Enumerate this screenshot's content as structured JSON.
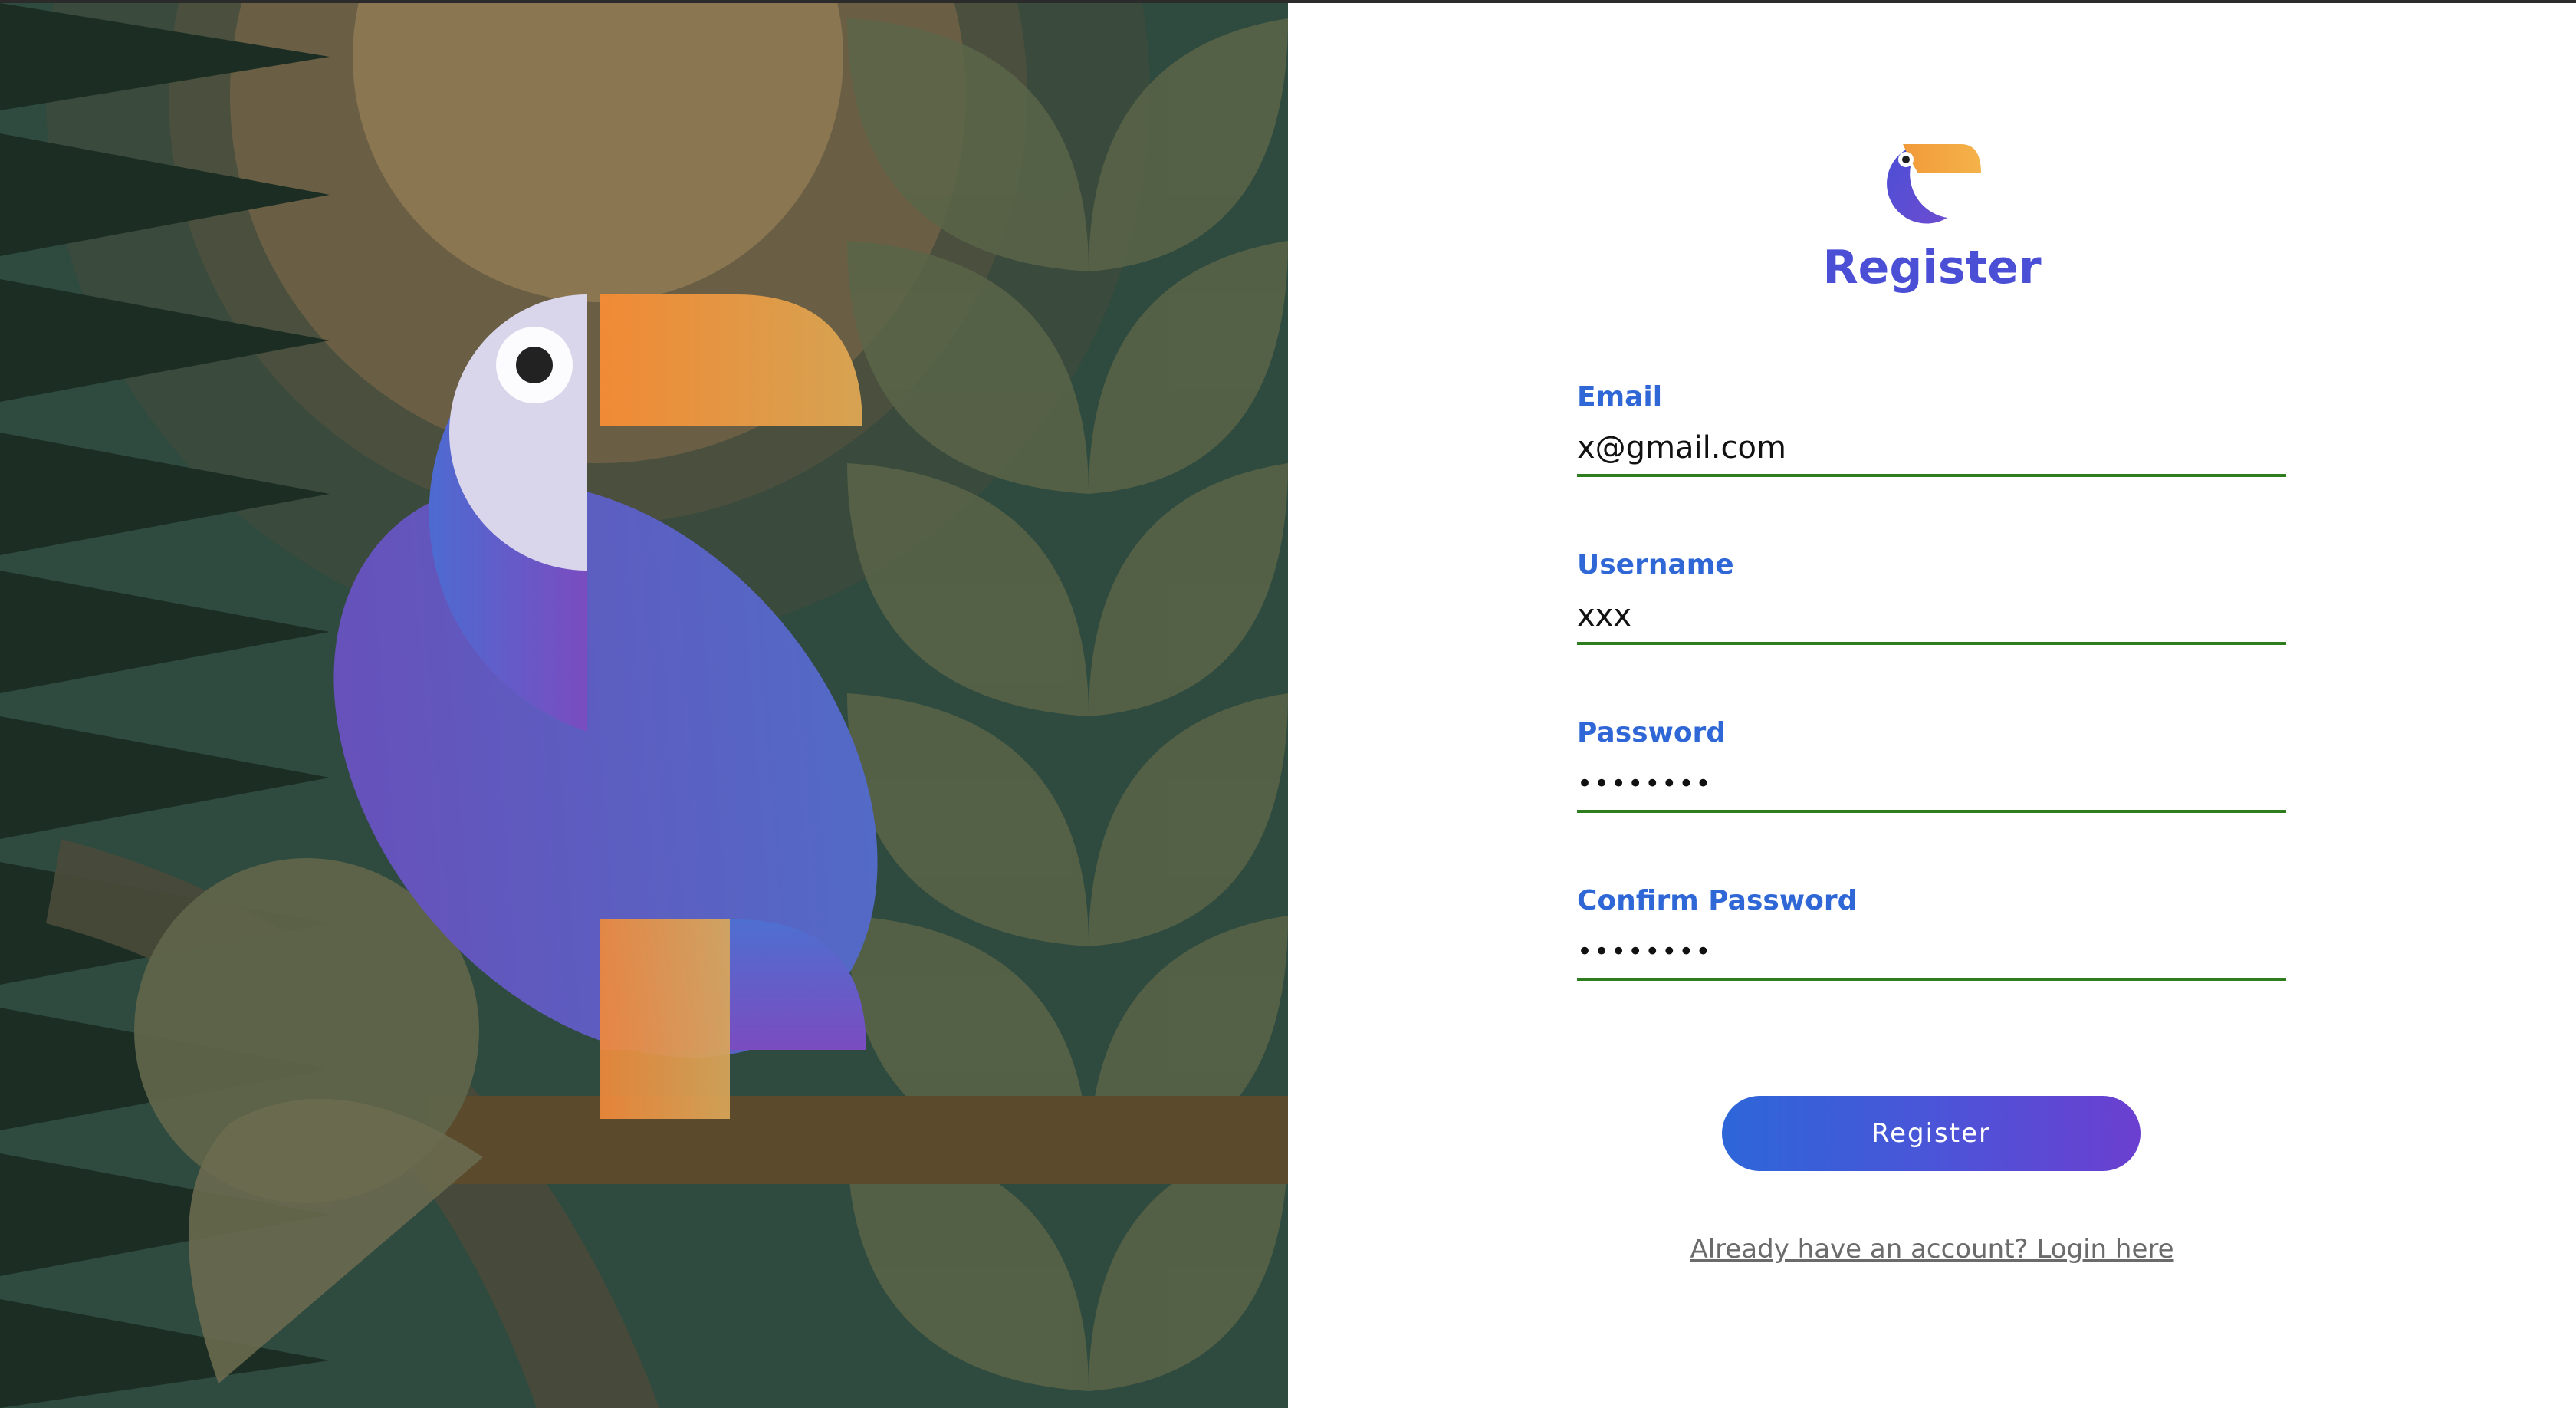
{
  "art": {
    "subject": "toucan-illustration",
    "colors": {
      "background": "#2f4a3f",
      "dark_leaves": "#1c2e24",
      "sun": "#8a7651",
      "leaves": "#5a6548",
      "body_start": "#4d6bd1",
      "body_end": "#7a4cc0",
      "face": "#d9d6ec",
      "beak_start": "#f08a35",
      "beak_end": "#d6a352",
      "branch": "#5c4a2c"
    }
  },
  "logo": {
    "icon": "toucan-logo-icon"
  },
  "form": {
    "title": "Register",
    "fields": {
      "email": {
        "label": "Email",
        "value": "x@gmail.com"
      },
      "username": {
        "label": "Username",
        "value": "xxx"
      },
      "password": {
        "label": "Password",
        "value": "xxxxxxxx"
      },
      "confirm_password": {
        "label": "Confirm Password",
        "value": "xxxxxxxx"
      }
    },
    "submit_label": "Register",
    "login_link_label": "Already have an account? Login here"
  },
  "theme": {
    "accent": "#4b4fd6",
    "label_color": "#2f67d6",
    "underline_color": "#2e7d1f",
    "button_gradient_start": "#2d66d8",
    "button_gradient_end": "#6b3fd0",
    "link_color": "#6b6b6b"
  }
}
